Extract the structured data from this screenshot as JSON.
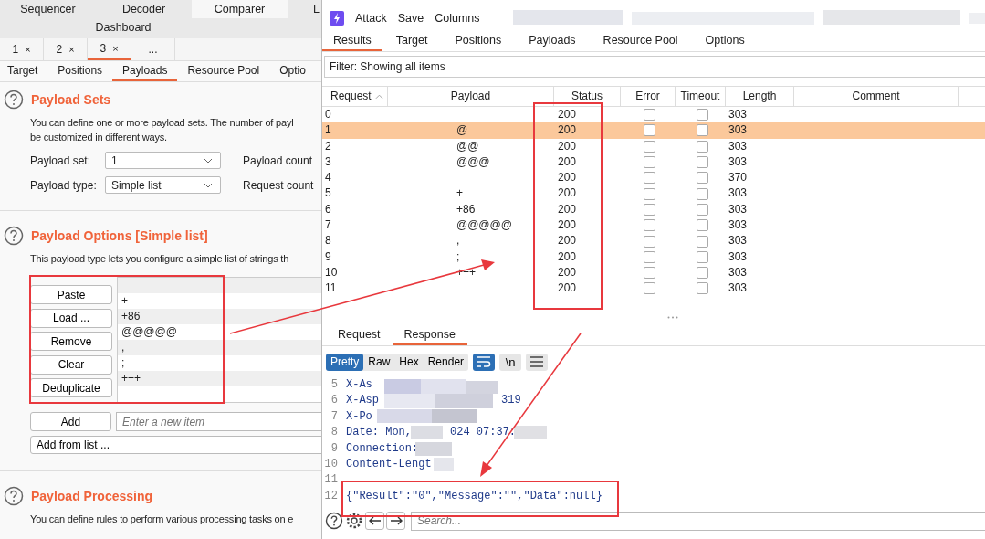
{
  "tool_tabs": [
    {
      "label": "Sequencer",
      "selected": false
    },
    {
      "label": "Decoder",
      "selected": false
    },
    {
      "label": "Comparer",
      "selected": true
    },
    {
      "label": "L",
      "selected": false
    },
    {
      "label": "Dashboard",
      "selected": false
    }
  ],
  "instance_tabs": [
    {
      "label": "1",
      "close": "×",
      "selected": false
    },
    {
      "label": "2",
      "close": "×",
      "selected": false
    },
    {
      "label": "3",
      "close": "×",
      "selected": true
    },
    {
      "label": "...",
      "selected": false
    }
  ],
  "sub_tabs": [
    {
      "label": "Target",
      "selected": false
    },
    {
      "label": "Positions",
      "selected": false
    },
    {
      "label": "Payloads",
      "selected": true
    },
    {
      "label": "Resource Pool",
      "selected": false
    },
    {
      "label": "Optio",
      "selected": false
    }
  ],
  "payload_sets": {
    "title": "Payload Sets",
    "description": [
      "You can define one or more payload sets. The number of payl",
      "be customized in different ways."
    ],
    "fields": [
      {
        "label": "Payload set:",
        "value": "1",
        "side": "Payload count"
      },
      {
        "label": "Payload type:",
        "value": "Simple list",
        "side": "Request count"
      }
    ]
  },
  "payload_options": {
    "title": "Payload Options [Simple list]",
    "description": "This payload type lets you configure a simple list of strings th",
    "buttons": [
      "Paste",
      "Load ...",
      "Remove",
      "Clear",
      "Deduplicate"
    ],
    "items": [
      "+",
      "+86",
      "@@@@@",
      ",",
      ";",
      "+++"
    ],
    "add_button": "Add",
    "add_placeholder": "Enter a new item",
    "add_from_list": "Add from list ..."
  },
  "payload_processing": {
    "title": "Payload Processing",
    "description": "You can define rules to perform various processing tasks on e"
  },
  "attack_window": {
    "menu": [
      "Attack",
      "Save",
      "Columns"
    ],
    "tabs": [
      {
        "label": "Results",
        "selected": true
      },
      {
        "label": "Target",
        "selected": false
      },
      {
        "label": "Positions",
        "selected": false
      },
      {
        "label": "Payloads",
        "selected": false
      },
      {
        "label": "Resource Pool",
        "selected": false
      },
      {
        "label": "Options",
        "selected": false
      }
    ],
    "filter": "Filter: Showing all items",
    "columns": [
      "Request",
      "Payload",
      "Status",
      "Error",
      "Timeout",
      "Length",
      "Comment"
    ],
    "rows": [
      {
        "request": "0",
        "status": "200",
        "error": false,
        "timeout": false,
        "length": "303",
        "selected": false
      },
      {
        "request": "1",
        "payload": "@",
        "status": "200",
        "error": false,
        "timeout": false,
        "length": "303",
        "selected": true
      },
      {
        "request": "2",
        "payload": "@@",
        "status": "200",
        "error": false,
        "timeout": false,
        "length": "303",
        "selected": false
      },
      {
        "request": "3",
        "payload": "@@@",
        "status": "200",
        "error": false,
        "timeout": false,
        "length": "303",
        "selected": false
      },
      {
        "request": "4",
        "status": "200",
        "error": false,
        "timeout": false,
        "length": "370",
        "selected": false
      },
      {
        "request": "5",
        "payload": "+",
        "status": "200",
        "error": false,
        "timeout": false,
        "length": "303",
        "selected": false
      },
      {
        "request": "6",
        "payload": "+86",
        "status": "200",
        "error": false,
        "timeout": false,
        "length": "303",
        "selected": false
      },
      {
        "request": "7",
        "payload": "@@@@@",
        "status": "200",
        "error": false,
        "timeout": false,
        "length": "303",
        "selected": false
      },
      {
        "request": "8",
        "payload": ",",
        "status": "200",
        "error": false,
        "timeout": false,
        "length": "303",
        "selected": false
      },
      {
        "request": "9",
        "payload": ";",
        "status": "200",
        "error": false,
        "timeout": false,
        "length": "303",
        "selected": false
      },
      {
        "request": "10",
        "payload": "+++",
        "status": "200",
        "error": false,
        "timeout": false,
        "length": "303",
        "selected": false
      },
      {
        "request": "11",
        "status": "200",
        "error": false,
        "timeout": false,
        "length": "303",
        "selected": false
      }
    ],
    "detail_tabs": [
      {
        "label": "Request",
        "selected": false
      },
      {
        "label": "Response",
        "selected": true
      }
    ],
    "view_buttons": [
      {
        "label": "Pretty",
        "selected": true
      },
      {
        "label": "Raw",
        "selected": false
      },
      {
        "label": "Hex",
        "selected": false
      },
      {
        "label": "Render",
        "selected": false
      }
    ],
    "newline_button": "\\n",
    "code_lines": [
      {
        "number": "5",
        "text": "X-As"
      },
      {
        "number": "6",
        "text": "X-Asp",
        "tail": "319"
      },
      {
        "number": "7",
        "text": "X-Po"
      },
      {
        "number": "8",
        "text": "Date: Mon,",
        "tail": "024 07:37:"
      },
      {
        "number": "9",
        "text": "Connection:"
      },
      {
        "number": "10",
        "text": "Content-Lengt"
      },
      {
        "number": "11"
      },
      {
        "number": "12",
        "text": "{\"Result\":\"0\",\"Message\":\"\",\"Data\":null}"
      }
    ],
    "search_placeholder": "Search..."
  }
}
